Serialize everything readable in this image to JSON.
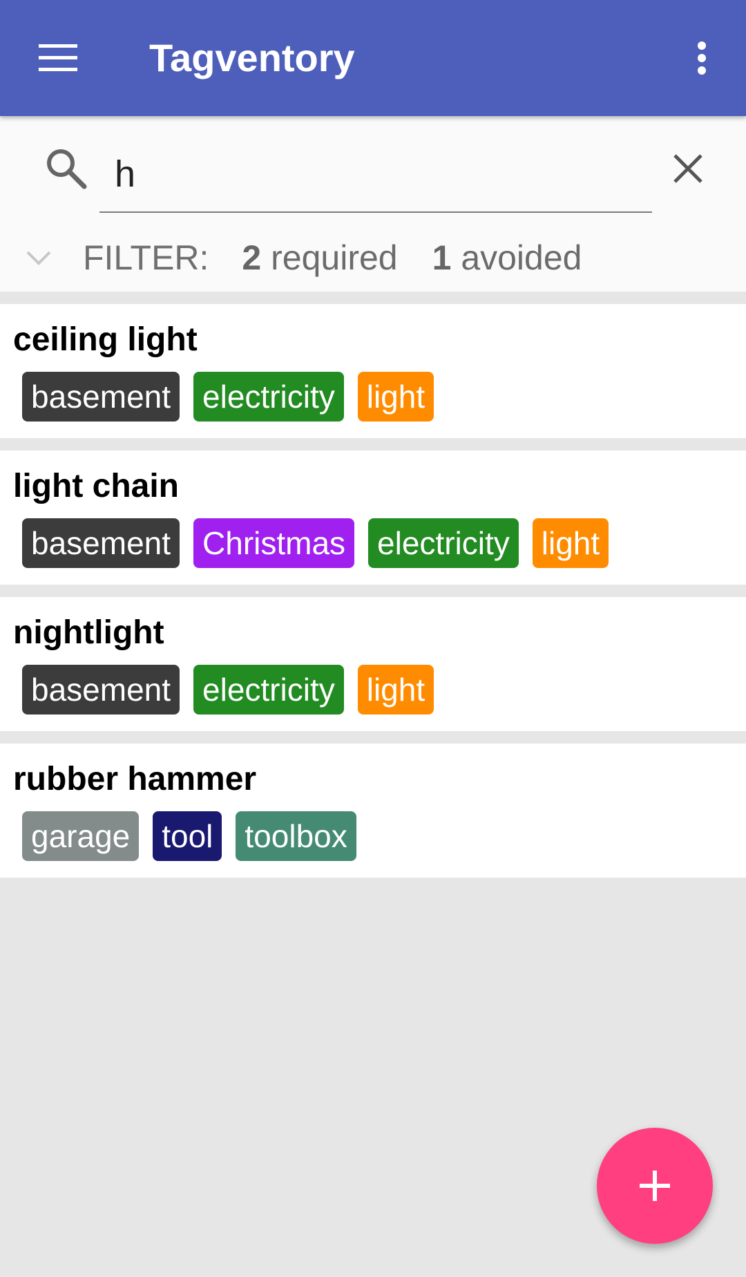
{
  "app_bar": {
    "title": "Tagventory",
    "menu_icon": "menu-icon",
    "overflow_icon": "more-vertical-icon",
    "background": "#4e5fbb"
  },
  "search": {
    "value": "h",
    "search_icon": "search-icon",
    "clear_icon": "close-icon"
  },
  "filter": {
    "label": "FILTER:",
    "required_count": "2",
    "required_label": "required",
    "avoided_count": "1",
    "avoided_label": "avoided",
    "toggle_icon": "chevron-down-icon"
  },
  "items": [
    {
      "name": "ceiling light",
      "tags": [
        {
          "label": "basement",
          "color": "#3c3c3c"
        },
        {
          "label": "electricity",
          "color": "#228b22"
        },
        {
          "label": "light",
          "color": "#ff8c00"
        }
      ]
    },
    {
      "name": "light chain",
      "tags": [
        {
          "label": "basement",
          "color": "#3c3c3c"
        },
        {
          "label": "Christmas",
          "color": "#a020f0"
        },
        {
          "label": "electricity",
          "color": "#228b22"
        },
        {
          "label": "light",
          "color": "#ff8c00"
        }
      ]
    },
    {
      "name": "nightlight",
      "tags": [
        {
          "label": "basement",
          "color": "#3c3c3c"
        },
        {
          "label": "electricity",
          "color": "#228b22"
        },
        {
          "label": "light",
          "color": "#ff8c00"
        }
      ]
    },
    {
      "name": "rubber hammer",
      "tags": [
        {
          "label": "garage",
          "color": "#838b8b"
        },
        {
          "label": "tool",
          "color": "#191970"
        },
        {
          "label": "toolbox",
          "color": "#458b74"
        }
      ]
    }
  ],
  "fab": {
    "icon": "add-icon",
    "color": "#ff3f80"
  }
}
